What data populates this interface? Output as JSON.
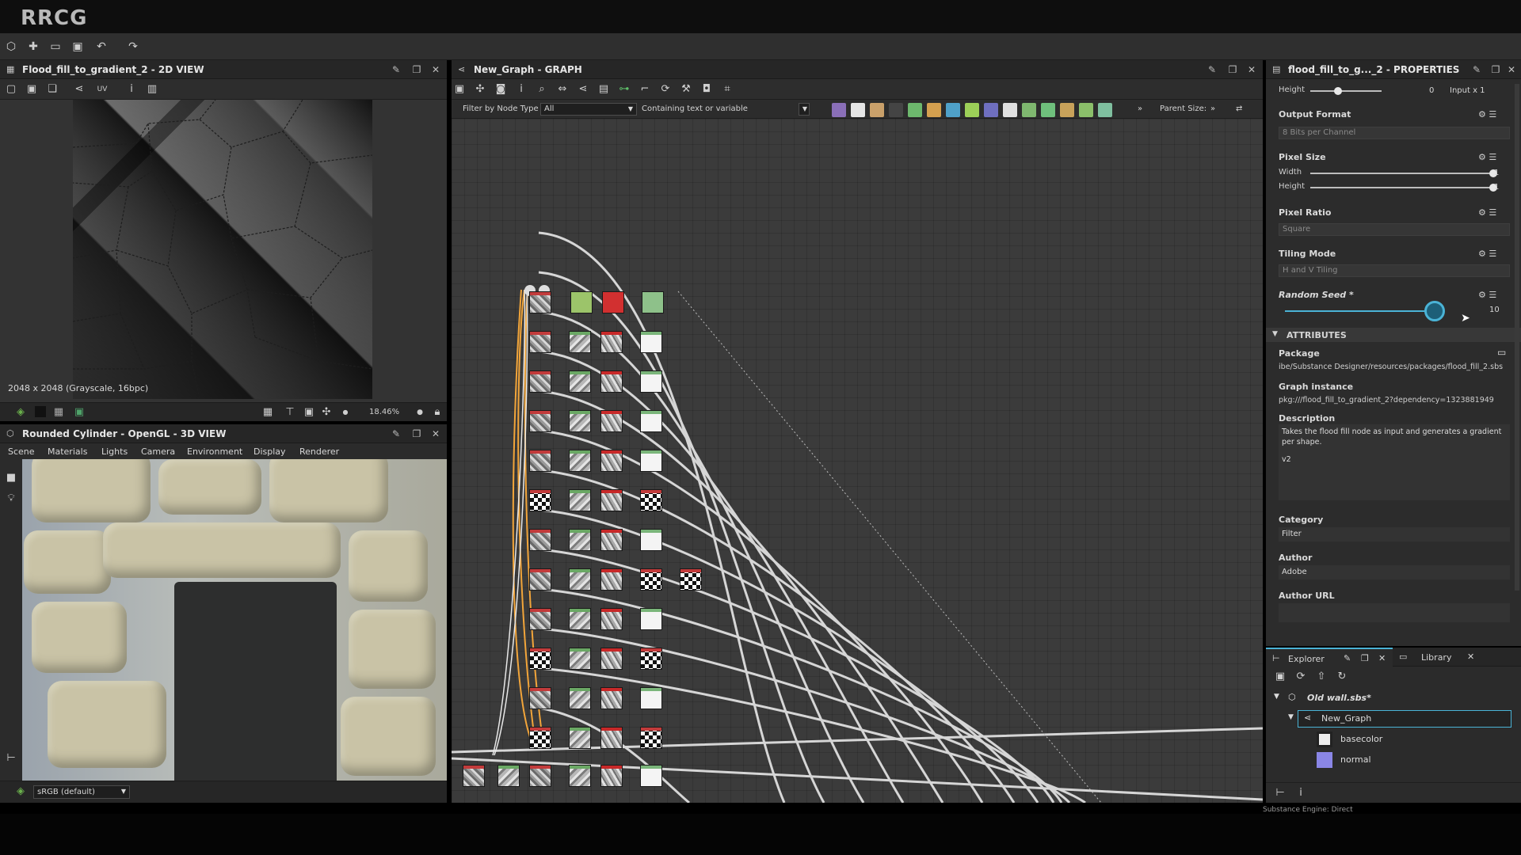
{
  "brand": "RRCG",
  "panel_2d": {
    "title": "Flood_fill_to_gradient_2 - 2D VIEW",
    "uv_label": "UV",
    "resolution_info": "2048 x 2048 (Grayscale, 16bpc)",
    "zoom": "18.46%"
  },
  "panel_3d": {
    "title": "Rounded Cylinder - OpenGL - 3D VIEW",
    "menu": [
      "Scene",
      "Materials",
      "Lights",
      "Camera",
      "Environment",
      "Display",
      "Renderer"
    ],
    "colorspace": "sRGB (default)"
  },
  "graph": {
    "title": "New_Graph - GRAPH",
    "filter_label": "Filter by Node Type",
    "filter_value": "All",
    "containing_label": "Containing text or variable",
    "parent_size_label": "Parent Size:"
  },
  "properties": {
    "title": "flood_fill_to_g..._2 - PROPERTIES",
    "height_label": "Height",
    "height_value": "0",
    "input_label": "Input x 1",
    "output_format_label": "Output Format",
    "output_format_value": "8 Bits per Channel",
    "pixel_size_label": "Pixel Size",
    "width_label": "Width",
    "width_value": "1",
    "height2_value": "1",
    "pixel_ratio_label": "Pixel Ratio",
    "pixel_ratio_value": "Square",
    "tiling_mode_label": "Tiling Mode",
    "tiling_mode_value": "H and V Tiling",
    "random_seed_label": "Random Seed *",
    "random_seed_value": "10",
    "random_seed_fraction": 0.95,
    "attributes_label": "ATTRIBUTES",
    "package_label": "Package",
    "package_value": "ibe/Substance Designer/resources/packages/flood_fill_2.sbs",
    "graph_instance_label": "Graph instance",
    "graph_instance_value": "pkg:///flood_fill_to_gradient_2?dependency=1323881949",
    "description_label": "Description",
    "description_value": "Takes the flood fill node as input and generates a gradient per shape.",
    "description_version": "v2",
    "category_label": "Category",
    "category_value": "Filter",
    "author_label": "Author",
    "author_value": "Adobe",
    "author_url_label": "Author URL"
  },
  "explorer": {
    "tab_explorer": "Explorer",
    "tab_library": "Library",
    "package": "Old wall.sbs*",
    "graph": "New_Graph",
    "outputs": [
      "basecolor",
      "normal"
    ],
    "status": "Substance Engine: Direct"
  }
}
